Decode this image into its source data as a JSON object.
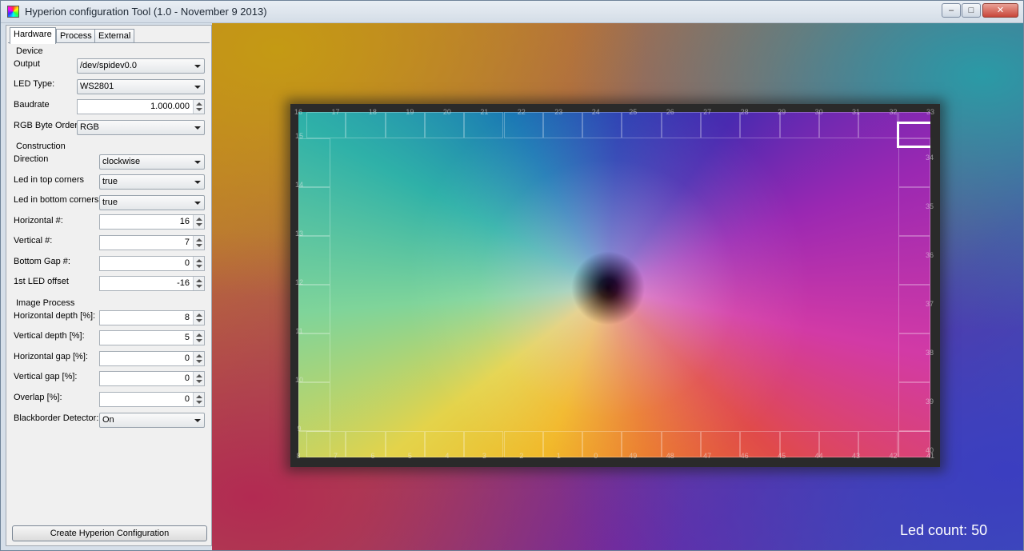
{
  "window": {
    "title": "Hyperion configuration Tool (1.0 - November 9 2013)",
    "min": "–",
    "max": "□",
    "close": "✕"
  },
  "tabs": [
    {
      "label": "Hardware",
      "active": true
    },
    {
      "label": "Process",
      "active": false
    },
    {
      "label": "External",
      "active": false
    }
  ],
  "device": {
    "group": "Device",
    "output_label": "Output",
    "output_value": "/dev/spidev0.0",
    "led_type_label": "LED Type:",
    "led_type_value": "WS2801",
    "baudrate_label": "Baudrate",
    "baudrate_value": "1.000.000",
    "rgb_order_label": "RGB Byte Order",
    "rgb_order_value": "RGB"
  },
  "construction": {
    "group": "Construction",
    "direction_label": "Direction",
    "direction_value": "clockwise",
    "top_corners_label": "Led in top corners",
    "top_corners_value": "true",
    "bottom_corners_label": "Led in bottom corners",
    "bottom_corners_value": "true",
    "horizontal_label": "Horizontal #:",
    "horizontal_value": "16",
    "vertical_label": "Vertical #:",
    "vertical_value": "7",
    "bottom_gap_label": "Bottom Gap #:",
    "bottom_gap_value": "0",
    "offset_label": "1st LED offset",
    "offset_value": "-16"
  },
  "image_process": {
    "group": "Image Process",
    "h_depth_label": "Horizontal depth [%]:",
    "h_depth_value": "8",
    "v_depth_label": "Vertical depth [%]:",
    "v_depth_value": "5",
    "h_gap_label": "Horizontal gap [%]:",
    "h_gap_value": "0",
    "v_gap_label": "Vertical gap [%]:",
    "v_gap_value": "0",
    "overlap_label": "Overlap [%]:",
    "overlap_value": "0",
    "blackborder_label": "Blackborder Detector:",
    "blackborder_value": "On"
  },
  "create_button": "Create Hyperion Configuration",
  "preview": {
    "led_count": "Led count: 50",
    "top_numbers": [
      "16",
      "17",
      "18",
      "19",
      "20",
      "21",
      "22",
      "23",
      "24",
      "25",
      "26",
      "27",
      "28",
      "29",
      "30",
      "31",
      "32",
      "33"
    ],
    "bottom_numbers": [
      "8",
      "7",
      "6",
      "5",
      "4",
      "3",
      "2",
      "1",
      "0",
      "49",
      "48",
      "47",
      "46",
      "45",
      "44",
      "43",
      "42",
      "41"
    ],
    "left_numbers": [
      "15",
      "14",
      "13",
      "12",
      "11",
      "10",
      "9"
    ],
    "right_numbers": [
      "34",
      "35",
      "36",
      "37",
      "38",
      "39",
      "40"
    ],
    "selected_led": 32
  }
}
